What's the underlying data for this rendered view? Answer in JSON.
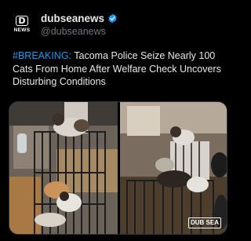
{
  "account": {
    "avatar_label": "NEWS",
    "display_name": "dubseanews",
    "handle": "@dubseanews",
    "verified": true,
    "verified_color": "#1d9bf0"
  },
  "tweet": {
    "hashtag": "#BREAKING:",
    "text": " Tacoma Police Seize Nearly 100 Cats From Home After Welfare Check Uncovers Disturbing Conditions",
    "hashtag_color": "#1d9bf0"
  },
  "media": {
    "watermark": "DUB SEA"
  }
}
